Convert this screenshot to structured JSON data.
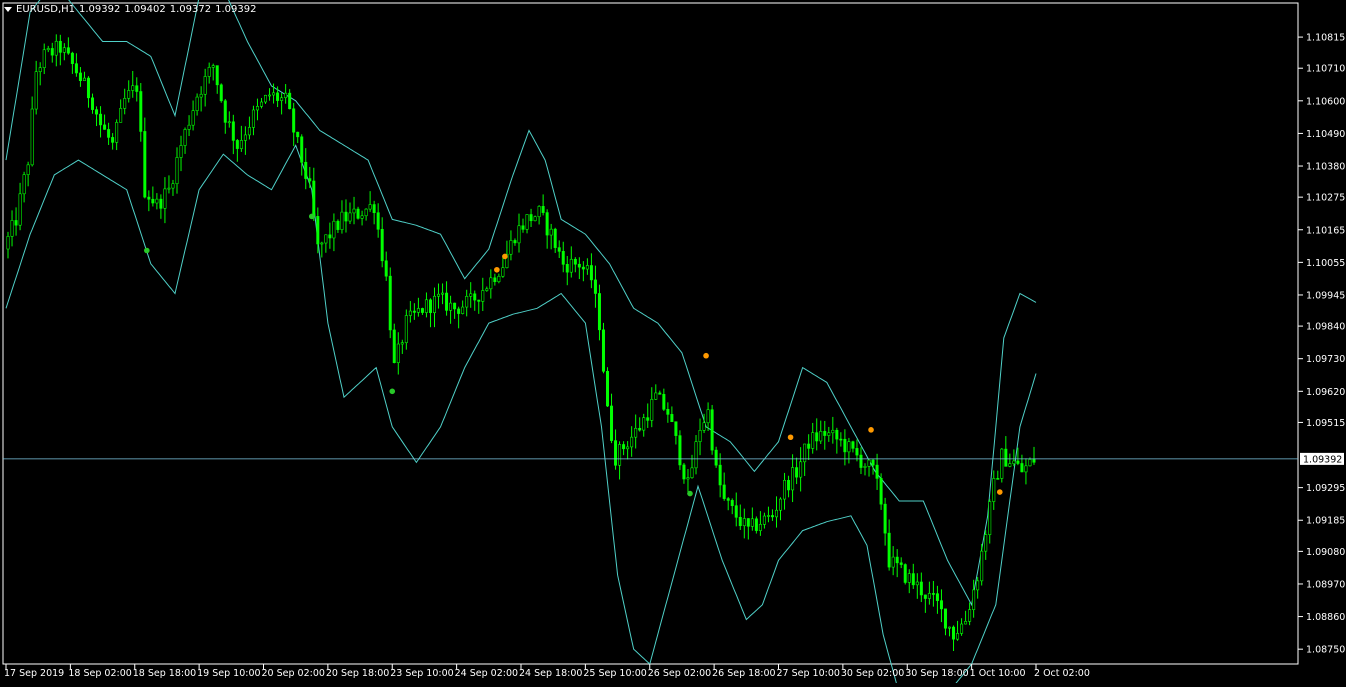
{
  "header": {
    "symbol_tf": "EURUSD,H1",
    "open": "1.09392",
    "high": "1.09402",
    "low": "1.09372",
    "close": "1.09392"
  },
  "colors": {
    "background": "#000000",
    "frame": "#ffffff",
    "candle_up": "#00ff00",
    "band": "#4fd0c8",
    "price_line": "#7ec8e3",
    "dot_green": "#28c828",
    "dot_orange": "#ff9900"
  },
  "chart_data": {
    "type": "candlestick",
    "symbol": "EURUSD",
    "timeframe": "H1",
    "current_price": 1.09392,
    "current_price_label": "1.09392",
    "ylim": [
      1.087,
      1.1093
    ],
    "y_ticks": [
      1.10815,
      1.1071,
      1.106,
      1.1049,
      1.1038,
      1.10275,
      1.10165,
      1.10055,
      1.09945,
      1.0984,
      1.0973,
      1.0962,
      1.09515,
      1.09295,
      1.09185,
      1.0908,
      1.0897,
      1.0886,
      1.0875
    ],
    "y_tick_labels": [
      "1.10815",
      "1.10710",
      "1.10600",
      "1.10490",
      "1.10380",
      "1.10275",
      "1.10165",
      "1.10055",
      "1.09945",
      "1.09840",
      "1.09730",
      "1.09620",
      "1.09515",
      "1.09295",
      "1.09185",
      "1.09080",
      "1.08970",
      "1.08860",
      "1.08750"
    ],
    "bars_total": 256,
    "x_ticks": [
      {
        "bar": 0,
        "label": "17 Sep 2019"
      },
      {
        "bar": 16,
        "label": "18 Sep 02:00"
      },
      {
        "bar": 32,
        "label": "18 Sep 18:00"
      },
      {
        "bar": 48,
        "label": "19 Sep 10:00"
      },
      {
        "bar": 64,
        "label": "20 Sep 02:00"
      },
      {
        "bar": 80,
        "label": "20 Sep 18:00"
      },
      {
        "bar": 96,
        "label": "23 Sep 10:00"
      },
      {
        "bar": 112,
        "label": "24 Sep 02:00"
      },
      {
        "bar": 128,
        "label": "24 Sep 18:00"
      },
      {
        "bar": 144,
        "label": "25 Sep 10:00"
      },
      {
        "bar": 160,
        "label": "26 Sep 02:00"
      },
      {
        "bar": 176,
        "label": "26 Sep 18:00"
      },
      {
        "bar": 192,
        "label": "27 Sep 10:00"
      },
      {
        "bar": 208,
        "label": "30 Sep 02:00"
      },
      {
        "bar": 224,
        "label": "30 Sep 18:00"
      },
      {
        "bar": 240,
        "label": "1 Oct 10:00"
      },
      {
        "bar": 256,
        "label": "2 Oct 02:00"
      }
    ],
    "price_anchors": [
      [
        0,
        1.101
      ],
      [
        3,
        1.102
      ],
      [
        6,
        1.104
      ],
      [
        8,
        1.107
      ],
      [
        10,
        1.1075
      ],
      [
        14,
        1.1078
      ],
      [
        18,
        1.107
      ],
      [
        22,
        1.106
      ],
      [
        24,
        1.1052
      ],
      [
        27,
        1.1045
      ],
      [
        30,
        1.106
      ],
      [
        33,
        1.1065
      ],
      [
        35,
        1.103
      ],
      [
        38,
        1.1025
      ],
      [
        41,
        1.103
      ],
      [
        44,
        1.1045
      ],
      [
        48,
        1.1062
      ],
      [
        52,
        1.1072
      ],
      [
        55,
        1.1055
      ],
      [
        58,
        1.1045
      ],
      [
        62,
        1.1055
      ],
      [
        66,
        1.1062
      ],
      [
        70,
        1.106
      ],
      [
        73,
        1.1045
      ],
      [
        76,
        1.103
      ],
      [
        78,
        1.101
      ],
      [
        81,
        1.1015
      ],
      [
        84,
        1.102
      ],
      [
        88,
        1.1022
      ],
      [
        92,
        1.1025
      ],
      [
        95,
        1.1
      ],
      [
        97,
        1.097
      ],
      [
        100,
        1.0985
      ],
      [
        104,
        1.099
      ],
      [
        108,
        1.0993
      ],
      [
        112,
        1.099
      ],
      [
        116,
        1.0992
      ],
      [
        120,
        1.0998
      ],
      [
        124,
        1.1005
      ],
      [
        127,
        1.1015
      ],
      [
        130,
        1.102
      ],
      [
        133,
        1.1022
      ],
      [
        136,
        1.1015
      ],
      [
        139,
        1.1005
      ],
      [
        143,
        1.1005
      ],
      [
        146,
        1.1
      ],
      [
        148,
        1.0985
      ],
      [
        150,
        1.0955
      ],
      [
        152,
        1.094
      ],
      [
        155,
        1.0945
      ],
      [
        158,
        1.095
      ],
      [
        162,
        1.096
      ],
      [
        165,
        1.0955
      ],
      [
        168,
        1.094
      ],
      [
        170,
        1.093
      ],
      [
        173,
        1.095
      ],
      [
        175,
        1.0955
      ],
      [
        177,
        1.0935
      ],
      [
        179,
        1.0925
      ],
      [
        182,
        1.092
      ],
      [
        185,
        1.0915
      ],
      [
        188,
        1.0918
      ],
      [
        191,
        1.092
      ],
      [
        194,
        1.093
      ],
      [
        197,
        1.0935
      ],
      [
        200,
        1.0945
      ],
      [
        204,
        1.0948
      ],
      [
        208,
        1.0945
      ],
      [
        212,
        1.094
      ],
      [
        216,
        1.0935
      ],
      [
        218,
        1.0925
      ],
      [
        220,
        1.0905
      ],
      [
        224,
        1.09
      ],
      [
        228,
        1.0895
      ],
      [
        232,
        1.089
      ],
      [
        236,
        1.088
      ],
      [
        239,
        1.0885
      ],
      [
        242,
        1.09
      ],
      [
        244,
        1.0915
      ],
      [
        246,
        1.093
      ],
      [
        248,
        1.094
      ],
      [
        251,
        1.0938
      ],
      [
        253,
        1.0935
      ],
      [
        256,
        1.0939
      ]
    ],
    "bands": {
      "upper": [
        [
          0,
          1.104
        ],
        [
          6,
          1.109
        ],
        [
          12,
          1.11
        ],
        [
          18,
          1.109
        ],
        [
          24,
          1.108
        ],
        [
          30,
          1.108
        ],
        [
          36,
          1.1075
        ],
        [
          42,
          1.1055
        ],
        [
          48,
          1.1095
        ],
        [
          54,
          1.1098
        ],
        [
          60,
          1.108
        ],
        [
          66,
          1.1065
        ],
        [
          72,
          1.106
        ],
        [
          78,
          1.105
        ],
        [
          84,
          1.1045
        ],
        [
          90,
          1.104
        ],
        [
          96,
          1.102
        ],
        [
          102,
          1.1018
        ],
        [
          108,
          1.1015
        ],
        [
          114,
          1.1
        ],
        [
          120,
          1.101
        ],
        [
          126,
          1.1035
        ],
        [
          130,
          1.105
        ],
        [
          134,
          1.104
        ],
        [
          138,
          1.102
        ],
        [
          144,
          1.1015
        ],
        [
          150,
          1.1005
        ],
        [
          156,
          1.099
        ],
        [
          162,
          1.0985
        ],
        [
          168,
          1.0975
        ],
        [
          174,
          1.095
        ],
        [
          180,
          1.0945
        ],
        [
          186,
          1.0935
        ],
        [
          192,
          1.0945
        ],
        [
          198,
          1.097
        ],
        [
          204,
          1.0965
        ],
        [
          210,
          1.095
        ],
        [
          216,
          1.0935
        ],
        [
          222,
          1.0925
        ],
        [
          228,
          1.0925
        ],
        [
          234,
          1.0905
        ],
        [
          240,
          1.089
        ],
        [
          244,
          1.092
        ],
        [
          248,
          1.098
        ],
        [
          252,
          1.0995
        ],
        [
          256,
          1.0992
        ]
      ],
      "lower": [
        [
          0,
          1.099
        ],
        [
          6,
          1.1015
        ],
        [
          12,
          1.1035
        ],
        [
          18,
          1.104
        ],
        [
          24,
          1.1035
        ],
        [
          30,
          1.103
        ],
        [
          36,
          1.1005
        ],
        [
          42,
          1.0995
        ],
        [
          48,
          1.103
        ],
        [
          54,
          1.1042
        ],
        [
          60,
          1.1035
        ],
        [
          66,
          1.103
        ],
        [
          72,
          1.1045
        ],
        [
          76,
          1.103
        ],
        [
          80,
          1.0985
        ],
        [
          84,
          1.096
        ],
        [
          88,
          1.0965
        ],
        [
          92,
          1.097
        ],
        [
          96,
          1.095
        ],
        [
          102,
          1.0938
        ],
        [
          108,
          1.095
        ],
        [
          114,
          1.097
        ],
        [
          120,
          1.0985
        ],
        [
          126,
          1.0988
        ],
        [
          132,
          1.099
        ],
        [
          138,
          1.0995
        ],
        [
          144,
          1.0985
        ],
        [
          148,
          1.095
        ],
        [
          152,
          1.09
        ],
        [
          156,
          1.0875
        ],
        [
          160,
          1.087
        ],
        [
          166,
          1.09
        ],
        [
          172,
          1.093
        ],
        [
          178,
          1.0905
        ],
        [
          184,
          1.0885
        ],
        [
          188,
          1.089
        ],
        [
          192,
          1.0905
        ],
        [
          198,
          1.0915
        ],
        [
          204,
          1.0918
        ],
        [
          210,
          1.092
        ],
        [
          214,
          1.091
        ],
        [
          218,
          1.088
        ],
        [
          222,
          1.086
        ],
        [
          228,
          1.0855
        ],
        [
          234,
          1.086
        ],
        [
          240,
          1.087
        ],
        [
          246,
          1.089
        ],
        [
          252,
          1.095
        ],
        [
          256,
          1.0968
        ]
      ]
    },
    "dots": [
      {
        "bar": 35,
        "price": 1.10095,
        "color": "green"
      },
      {
        "bar": 76,
        "price": 1.1021,
        "color": "green"
      },
      {
        "bar": 96,
        "price": 1.0962,
        "color": "green"
      },
      {
        "bar": 122,
        "price": 1.1003,
        "color": "orange"
      },
      {
        "bar": 124,
        "price": 1.10075,
        "color": "orange"
      },
      {
        "bar": 174,
        "price": 1.0974,
        "color": "orange"
      },
      {
        "bar": 170,
        "price": 1.09275,
        "color": "green"
      },
      {
        "bar": 195,
        "price": 1.09465,
        "color": "orange"
      },
      {
        "bar": 215,
        "price": 1.0949,
        "color": "orange"
      },
      {
        "bar": 247,
        "price": 1.0928,
        "color": "orange"
      }
    ]
  }
}
